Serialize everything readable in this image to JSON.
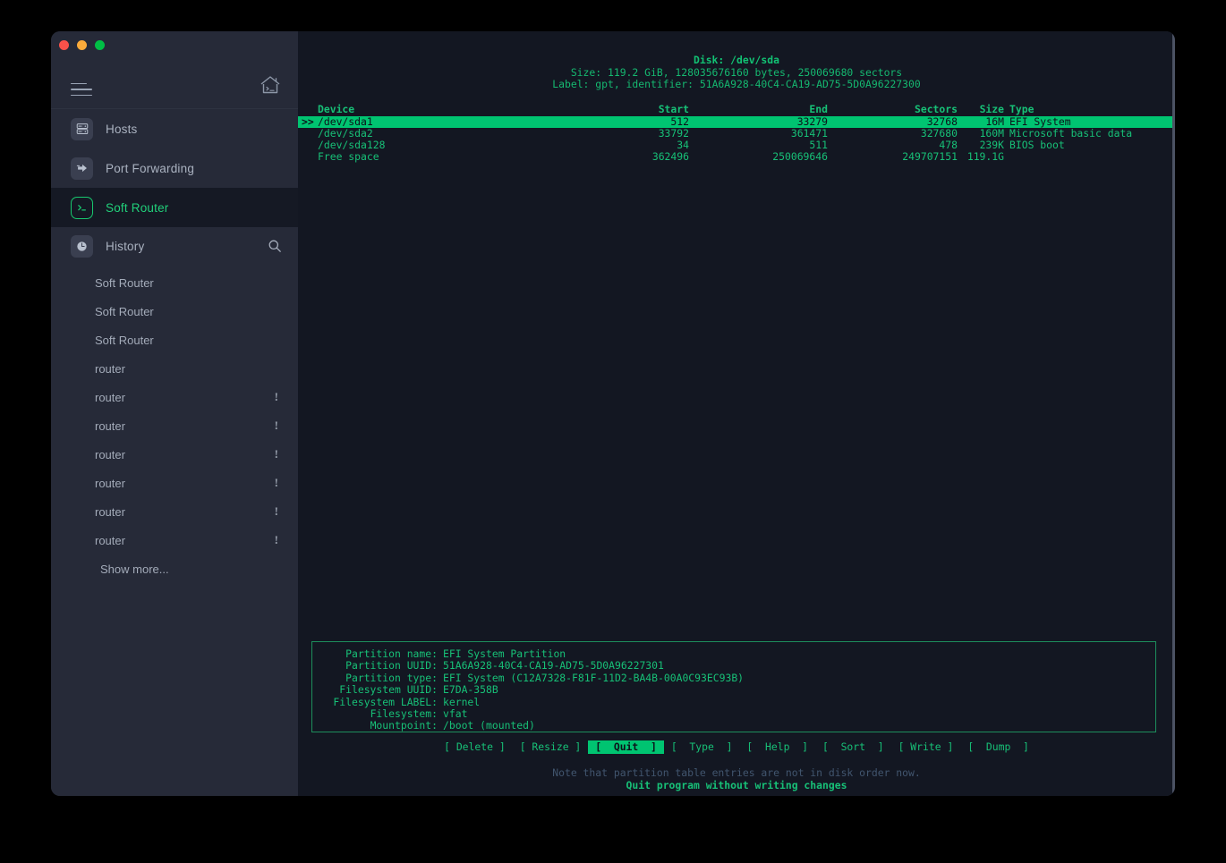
{
  "window": {
    "traffic_lights": [
      "close",
      "minimize",
      "maximize"
    ],
    "colors": {
      "page_bg": "#000000",
      "window_bg": "#262a38",
      "terminal_bg": "#131722",
      "accent_green": "#00c471",
      "text_green": "#17c077",
      "sidebar_active_bg": "#151924",
      "muted_blue": "#41556e",
      "traffic_red": "#f9514a",
      "traffic_yellow": "#fbab3b",
      "traffic_green": "#00bf45"
    }
  },
  "sidebar": {
    "menu_icon": "hamburger-icon",
    "home_icon": "home-terminal-icon",
    "nav": [
      {
        "label": "Hosts",
        "icon": "server-rack-icon",
        "active": false
      },
      {
        "label": "Port Forwarding",
        "icon": "forward-arrow-icon",
        "active": false
      },
      {
        "label": "Soft Router",
        "icon": "terminal-prompt-icon",
        "active": true
      }
    ],
    "history": {
      "label": "History",
      "icon": "clock-icon",
      "search_icon": "search-icon",
      "items": [
        {
          "label": "Soft Router",
          "warning": ""
        },
        {
          "label": "Soft Router",
          "warning": ""
        },
        {
          "label": "Soft Router",
          "warning": ""
        },
        {
          "label": "router",
          "warning": ""
        },
        {
          "label": "router",
          "warning": "!"
        },
        {
          "label": "router",
          "warning": "!"
        },
        {
          "label": "router",
          "warning": "!"
        },
        {
          "label": "router",
          "warning": "!"
        },
        {
          "label": "router",
          "warning": "!"
        },
        {
          "label": "router",
          "warning": "!"
        }
      ],
      "show_more": "Show more..."
    }
  },
  "terminal": {
    "disk": {
      "title": "Disk: /dev/sda",
      "size_line": "Size: 119.2 GiB, 128035676160 bytes, 250069680 sectors",
      "label_line": "Label: gpt, identifier: 51A6A928-40C4-CA19-AD75-5D0A96227300"
    },
    "table": {
      "headers": {
        "device": "Device",
        "start": "Start",
        "end": "End",
        "sectors": "Sectors",
        "size_type": "Size Type"
      },
      "size_header": "Size",
      "type_header": "Type",
      "cursor_marker": ">>",
      "rows": [
        {
          "device": "/dev/sda1",
          "start": "512",
          "end": "33279",
          "sectors": "32768",
          "size": "16M",
          "type": "EFI System",
          "selected": true
        },
        {
          "device": "/dev/sda2",
          "start": "33792",
          "end": "361471",
          "sectors": "327680",
          "size": "160M",
          "type": "Microsoft basic data",
          "selected": false
        },
        {
          "device": "/dev/sda128",
          "start": "34",
          "end": "511",
          "sectors": "478",
          "size": "239K",
          "type": "BIOS boot",
          "selected": false
        },
        {
          "device": "Free space",
          "start": "362496",
          "end": "250069646",
          "sectors": "249707151",
          "size": "119.1G",
          "type": "",
          "selected": false
        }
      ]
    },
    "detail": [
      {
        "key": "Partition name:",
        "value": "EFI System Partition"
      },
      {
        "key": "Partition UUID:",
        "value": "51A6A928-40C4-CA19-AD75-5D0A96227301"
      },
      {
        "key": "Partition type:",
        "value": "EFI System (C12A7328-F81F-11D2-BA4B-00A0C93EC93B)"
      },
      {
        "key": "Filesystem UUID:",
        "value": "E7DA-358B"
      },
      {
        "key": "Filesystem LABEL:",
        "value": "kernel"
      },
      {
        "key": "Filesystem:",
        "value": "vfat"
      },
      {
        "key": "Mountpoint:",
        "value": "/boot (mounted)"
      }
    ],
    "buttons": [
      {
        "label": "[ Delete ]",
        "selected": false
      },
      {
        "label": "[ Resize ]",
        "selected": false
      },
      {
        "label": "[  Quit  ]",
        "selected": true
      },
      {
        "label": "[  Type  ]",
        "selected": false
      },
      {
        "label": "[  Help  ]",
        "selected": false
      },
      {
        "label": "[  Sort  ]",
        "selected": false
      },
      {
        "label": "[ Write ]",
        "selected": false
      },
      {
        "label": "[  Dump  ]",
        "selected": false
      }
    ],
    "footer_note": "Note that partition table entries are not in disk order now.",
    "footer_hint": "Quit program without writing changes"
  }
}
